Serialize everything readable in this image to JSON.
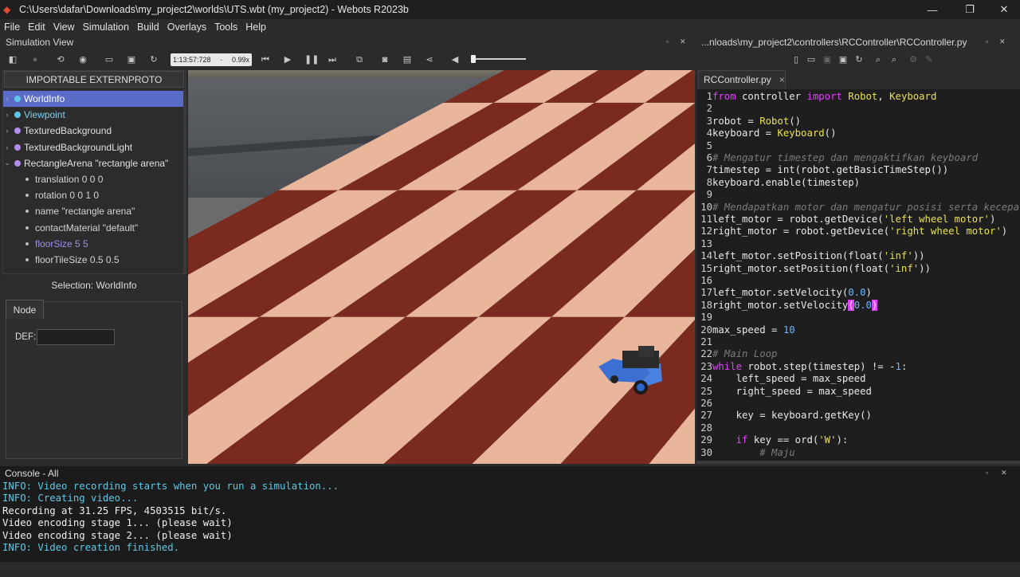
{
  "window": {
    "title": "C:\\Users\\dafar\\Downloads\\my_project2\\worlds\\UTS.wbt (my_project2) - Webots R2023b",
    "controls": [
      "—",
      "❐",
      "✕"
    ]
  },
  "menu": [
    "File",
    "Edit",
    "View",
    "Simulation",
    "Build",
    "Overlays",
    "Tools",
    "Help"
  ],
  "simulation_view": {
    "title": "Simulation View",
    "time": "1:13:57:728",
    "speed": "0.99x",
    "dock_buttons": [
      "▫",
      "✕"
    ]
  },
  "scene_tree": {
    "externproto_button": "IMPORTABLE EXTERNPROTO",
    "nodes": [
      {
        "label": "WorldInfo",
        "color": "#5ec8e6",
        "selected": true
      },
      {
        "label": "Viewpoint",
        "color": "#5ec8e6",
        "selected": false
      },
      {
        "label": "TexturedBackground",
        "color": "#b48cf0",
        "selected": false
      },
      {
        "label": "TexturedBackgroundLight",
        "color": "#b48cf0",
        "selected": false
      },
      {
        "label": "RectangleArena \"rectangle arena\"",
        "color": "#b48cf0",
        "selected": false
      }
    ],
    "fields": [
      {
        "label": "translation 0 0 0",
        "modified": false
      },
      {
        "label": "rotation 0 0 1 0",
        "modified": false
      },
      {
        "label": "name \"rectangle arena\"",
        "modified": false
      },
      {
        "label": "contactMaterial \"default\"",
        "modified": false
      },
      {
        "label": "floorSize 5 5",
        "modified": true
      },
      {
        "label": "floorTileSize 0.5 0.5",
        "modified": false
      }
    ]
  },
  "selection": {
    "title": "Selection: WorldInfo",
    "tab": "Node",
    "def_label": "DEF:",
    "def_value": ""
  },
  "editor": {
    "path": "...nloads\\my_project2\\controllers\\RCController\\RCController.py",
    "tab": "RCController.py",
    "tab_close": "×"
  },
  "console": {
    "title": "Console - All",
    "lines": [
      {
        "text": "INFO: Video recording starts when you run a simulation...",
        "color": "#5ec8e6"
      },
      {
        "text": "INFO: Creating video...",
        "color": "#5ec8e6"
      },
      {
        "text": "Recording at 31.25 FPS, 4503515 bit/s.",
        "color": "#f0f0f0"
      },
      {
        "text": "Video encoding stage 1... (please wait)",
        "color": "#f0f0f0"
      },
      {
        "text": "Video encoding stage 2... (please wait)",
        "color": "#f0f0f0"
      },
      {
        "text": "INFO: Video creation finished.",
        "color": "#5ec8e6"
      }
    ]
  },
  "colors": {
    "accent": "#5a6cc8",
    "keyword": "#e040fb",
    "string": "#e8e050",
    "number": "#6ab8ff",
    "comment": "#7a7a7a"
  }
}
